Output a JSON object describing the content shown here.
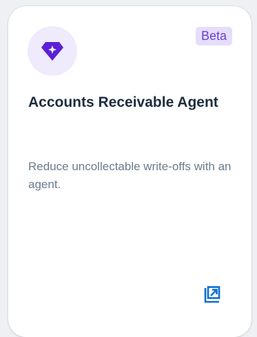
{
  "card": {
    "icon": "diamond-sparkle-icon",
    "badge": "Beta",
    "title": "Accounts Receivable Agent",
    "description": "Reduce uncollectable write-offs with an agent.",
    "action_icon": "open-external-icon"
  },
  "colors": {
    "icon_bg": "#efeafc",
    "icon_fg": "#5d1fd6",
    "badge_bg": "#e6ddfb",
    "badge_fg": "#6b40d4",
    "title": "#1d2d3e",
    "description": "#6a7b8e",
    "action": "#0a6ed1"
  }
}
